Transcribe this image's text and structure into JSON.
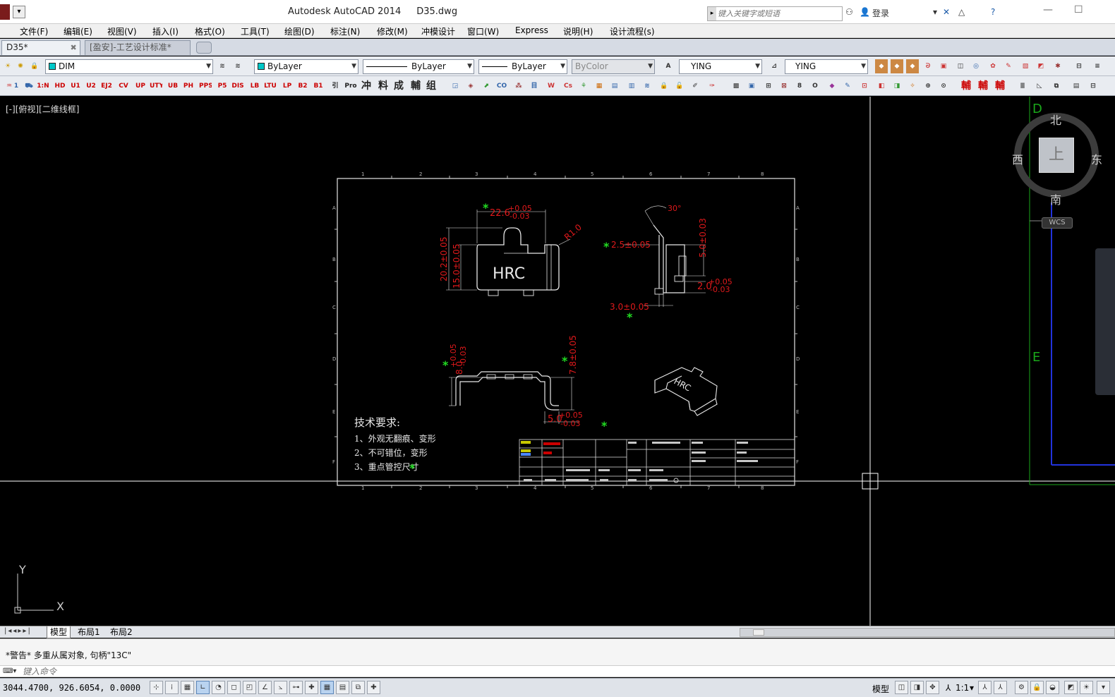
{
  "window": {
    "app_title": "Autodesk AutoCAD 2014",
    "file_title": "D35.dwg",
    "search_placeholder": "键入关键字或短语",
    "login_label": "登录"
  },
  "menu": [
    "文件(F)",
    "编辑(E)",
    "视图(V)",
    "插入(I)",
    "格式(O)",
    "工具(T)",
    "绘图(D)",
    "标注(N)",
    "修改(M)",
    "冲模设计",
    "窗口(W)",
    "Express",
    "说明(H)",
    "设计流程(s)"
  ],
  "doc_tabs": [
    {
      "label": "D35*",
      "active": true
    },
    {
      "label": "[盈安]-工艺设计标准*",
      "active": false
    }
  ],
  "properties_toolbar": {
    "layer": "DIM",
    "color": "ByLayer",
    "linetype": "ByLayer",
    "lineweight": "ByLayer",
    "plotstyle": "ByColor",
    "text_style": "YING",
    "dim_style": "YING",
    "accent_color": "#00c8c8"
  },
  "custom_toolbar_icons": [
    "1:N",
    "HD",
    "U1",
    "U2",
    "EJ2",
    "CV",
    "UP",
    "UTY",
    "UB",
    "PH",
    "PPS",
    "P5",
    "DIS",
    "LB",
    "LTU",
    "LP",
    "B2",
    "B1",
    "引",
    "Pro",
    "冲",
    "料",
    "成",
    "輔",
    "组"
  ],
  "viewport": {
    "label": "[-][俯视][二维线框]",
    "crosshair_color": "#ffffff",
    "dim_color": "#e0191b",
    "star_color": "#22dd22"
  },
  "viewcube": {
    "north": "北",
    "south": "南",
    "east": "东",
    "west": "西",
    "top": "上",
    "wcs": "WCS"
  },
  "drawing": {
    "top_zone_numbers": [
      "1",
      "2",
      "3",
      "4",
      "5",
      "6",
      "7",
      "8"
    ],
    "side_zone_letters": [
      "A",
      "B",
      "C",
      "D",
      "E",
      "F"
    ],
    "dims": {
      "width_top": "22.6",
      "width_tol_plus": "+0.05",
      "width_tol_minus": "-0.03",
      "radius": "R1.0",
      "height_outer": "20.2±0.05",
      "height_inner": "15.0±0.05",
      "logo": "HRC",
      "side_offset": "2.5±0.05",
      "side_height": "5.0±0.03",
      "side_thk": "2.0",
      "side_thk_plus": "+0.05",
      "side_thk_minus": "-0.03",
      "angle": "30°",
      "bottom_gap": "3.0±0.05",
      "front_left": "8.0",
      "front_left_plus": "+0.05",
      "front_left_minus": "-0.03",
      "front_right": "7.8±0.05",
      "front_bottom": "5.0",
      "front_bottom_plus": "+0.05",
      "front_bottom_minus": "-0.03"
    },
    "notes_title": "技术要求:",
    "notes": [
      "1、外观无翻痕、变形",
      "2、不可错位，变形",
      "3、重点管控尺寸"
    ]
  },
  "right_zone_letters": [
    "D",
    "E"
  ],
  "layout_tabs": [
    "模型",
    "布局1",
    "布局2"
  ],
  "command": {
    "history": "*警告*  多重从属对象, 句柄\"13C\"",
    "placeholder": "键入命令"
  },
  "status": {
    "coords": "3044.4700,  926.6054,  0.0000",
    "model_label": "模型",
    "scale": "1:1"
  }
}
